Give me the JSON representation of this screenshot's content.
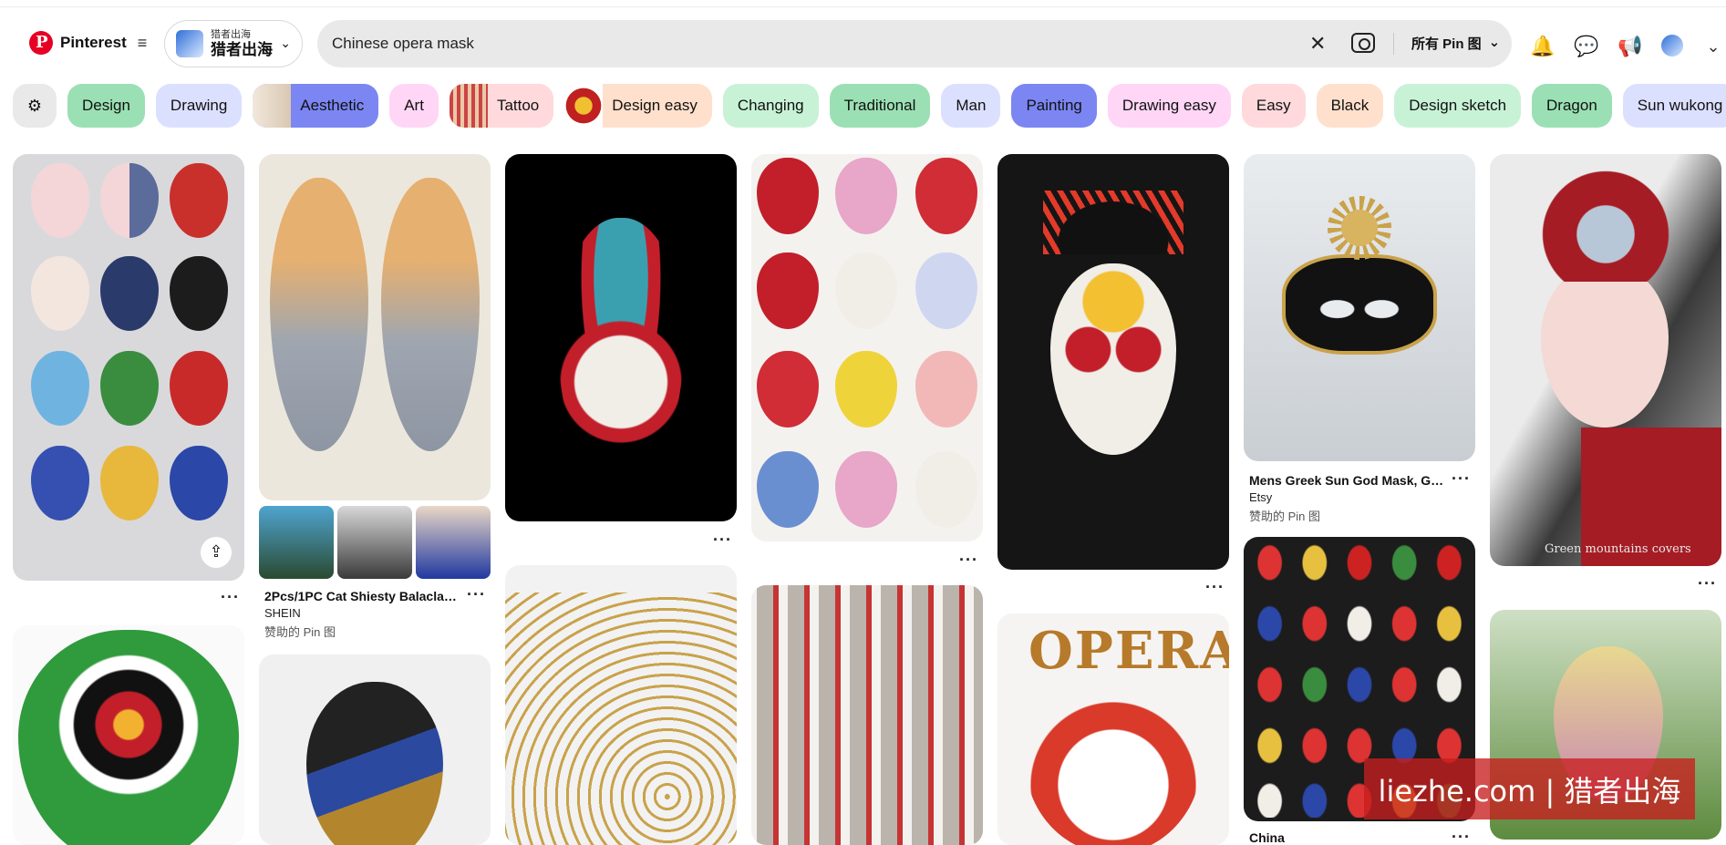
{
  "brand": {
    "name": "Pinterest"
  },
  "account": {
    "name_small": "猎者出海",
    "name_big": "猎者出海"
  },
  "search": {
    "query": "Chinese opera mask",
    "filter_label": "所有 Pin 图"
  },
  "chips": [
    {
      "label": "Design",
      "color": "#9be0b4"
    },
    {
      "label": "Drawing",
      "color": "#dce0ff"
    },
    {
      "label": "Aesthetic",
      "color": "#7b86f2"
    },
    {
      "label": "Art",
      "color": "#ffd6f6"
    },
    {
      "label": "Tattoo",
      "color": "#ffd9dc"
    },
    {
      "label": "Design easy",
      "color": "#ffe0cc"
    },
    {
      "label": "Changing",
      "color": "#c8f2d6"
    },
    {
      "label": "Traditional",
      "color": "#9be0b4"
    },
    {
      "label": "Man",
      "color": "#dce0ff"
    },
    {
      "label": "Painting",
      "color": "#7b86f2"
    },
    {
      "label": "Drawing easy",
      "color": "#ffd6f6"
    },
    {
      "label": "Easy",
      "color": "#ffd9dc"
    },
    {
      "label": "Black",
      "color": "#ffe0cc"
    },
    {
      "label": "Design sketch",
      "color": "#c8f2d6"
    },
    {
      "label": "Dragon",
      "color": "#9be0b4"
    },
    {
      "label": "Sun wukong",
      "color": "#dce0ff"
    }
  ],
  "pins": {
    "cat_balaclava": {
      "title": "2Pcs/1PC Cat Shiesty Balaclava...",
      "source": "SHEIN",
      "promo": "赞助的 Pin 图"
    },
    "greek_mask": {
      "title": "Mens Greek Sun God Mask, Gol...",
      "source": "Etsy",
      "promo": "赞助的 Pin 图"
    },
    "china_masks": {
      "title": "China"
    },
    "opera_sign": {
      "text": "OPERA"
    },
    "warrior_caption": {
      "text": "Green mountains covers"
    }
  },
  "more_glyph": "···",
  "watermark": "liezhe.com | 猎者出海",
  "colors": {
    "brand_red": "#e60023",
    "search_bg": "#e9e9e9"
  }
}
